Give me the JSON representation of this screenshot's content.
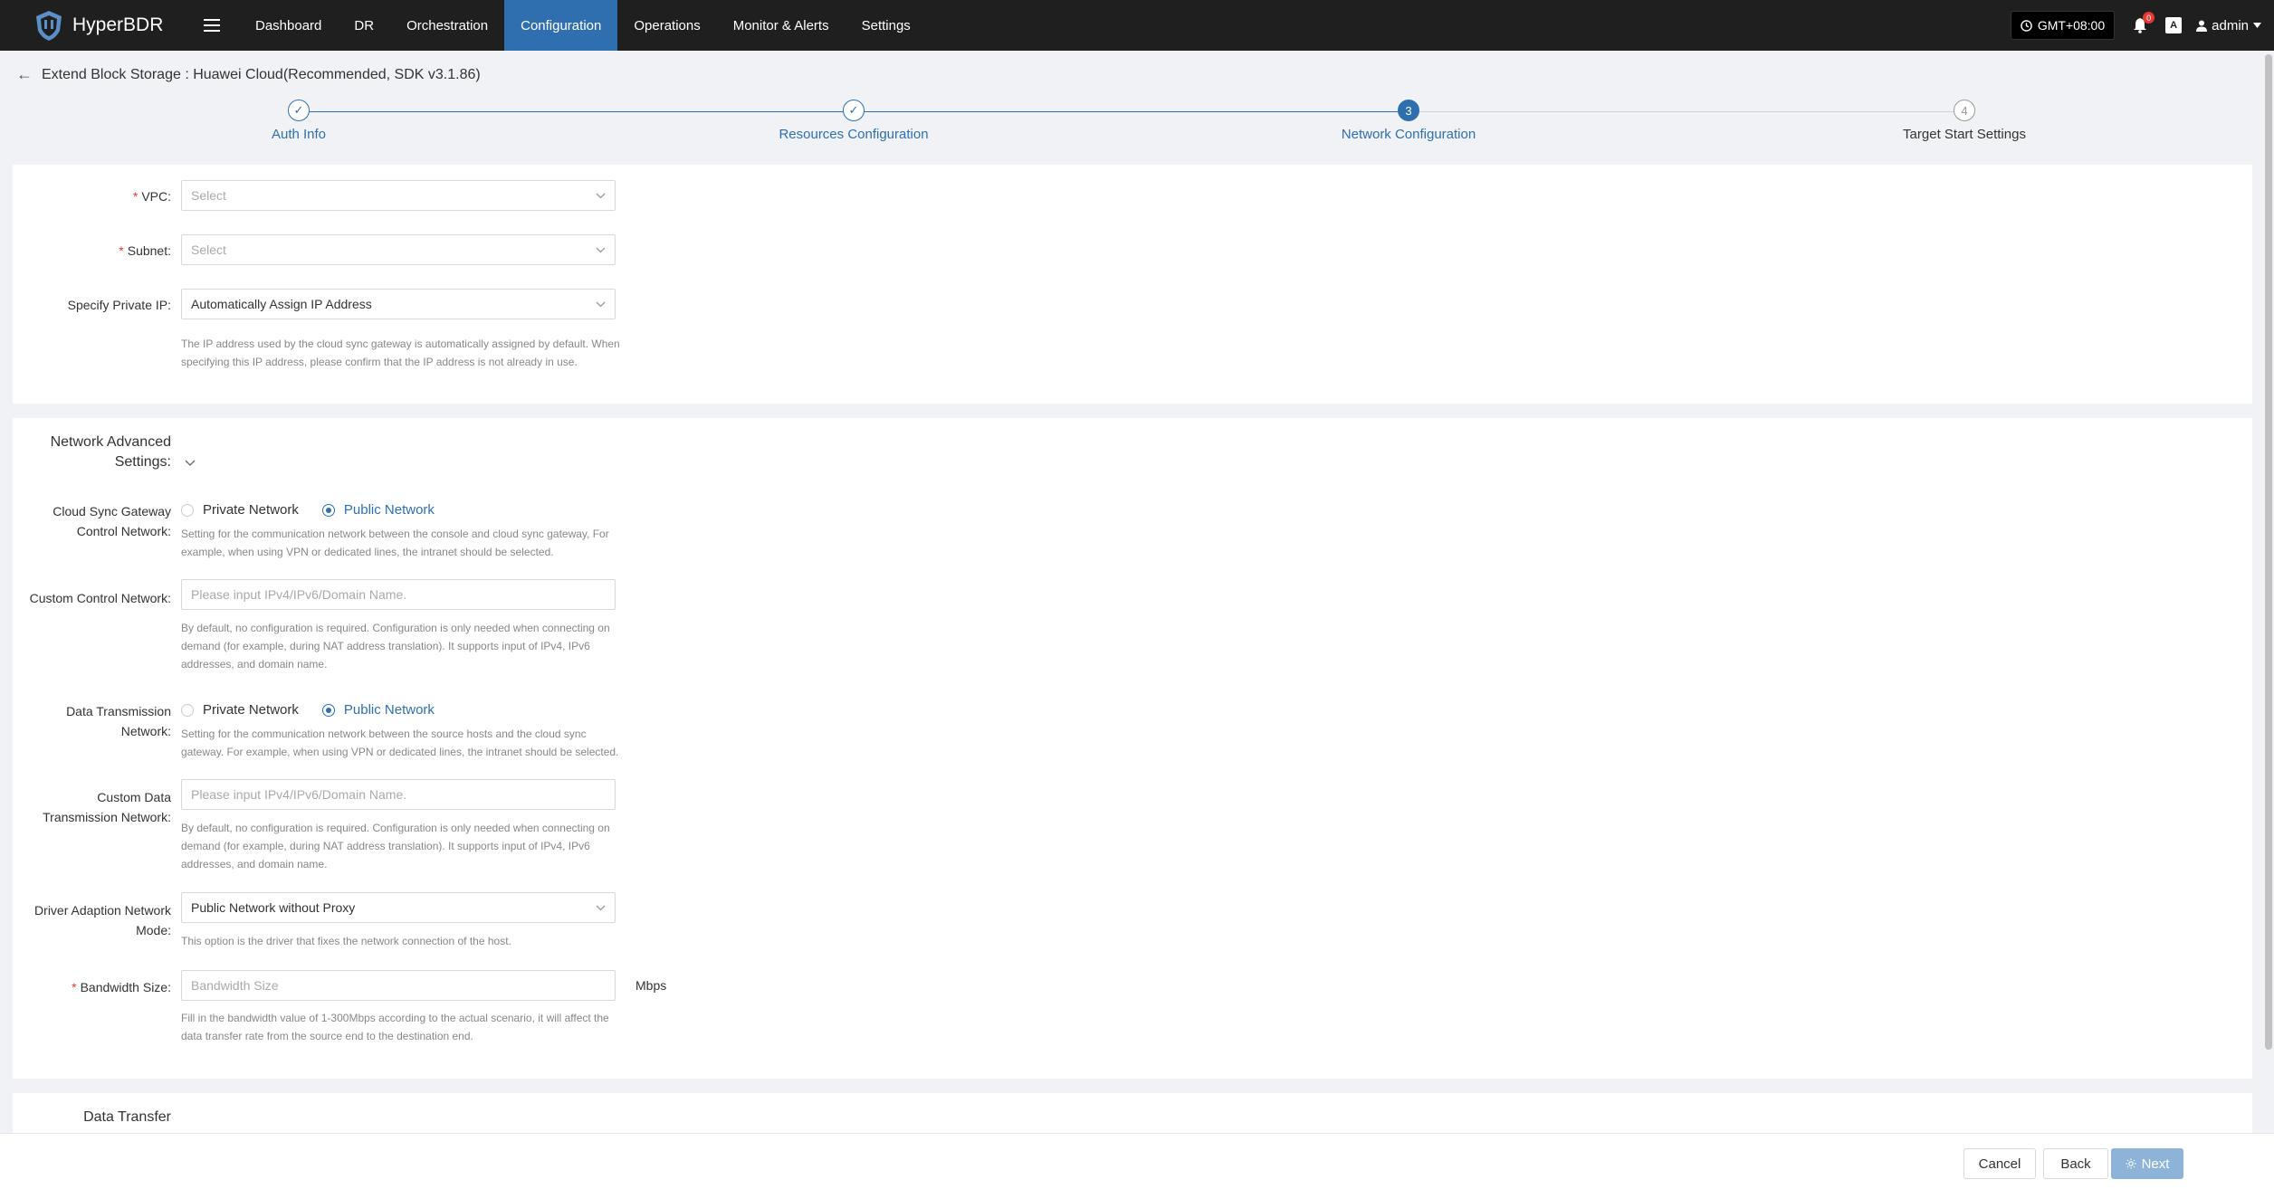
{
  "app": {
    "name": "HyperBDR"
  },
  "nav": {
    "items": [
      {
        "label": "Dashboard"
      },
      {
        "label": "DR"
      },
      {
        "label": "Orchestration"
      },
      {
        "label": "Configuration",
        "active": true
      },
      {
        "label": "Operations"
      },
      {
        "label": "Monitor & Alerts"
      },
      {
        "label": "Settings"
      }
    ],
    "timezone": "GMT+08:00",
    "notification_count": "0",
    "lang_glyph": "A",
    "user": "admin"
  },
  "page": {
    "title": "Extend Block Storage : Huawei Cloud(Recommended, SDK v3.1.86)"
  },
  "steps": [
    {
      "label": "Auth Info",
      "status": "done",
      "marker": "✓"
    },
    {
      "label": "Resources Configuration",
      "status": "done",
      "marker": "✓"
    },
    {
      "label": "Network Configuration",
      "status": "current",
      "marker": "3"
    },
    {
      "label": "Target Start Settings",
      "status": "todo",
      "marker": "4"
    }
  ],
  "network": {
    "vpc": {
      "label": "VPC:",
      "placeholder": "Select"
    },
    "subnet": {
      "label": "Subnet:",
      "placeholder": "Select"
    },
    "private_ip": {
      "label": "Specify Private IP:",
      "value": "Automatically Assign IP Address",
      "hint_line1": "The IP address used by the cloud sync gateway is automatically assigned by default. When",
      "hint_line2": "specifying this IP address, please confirm that the IP address is not already in use."
    }
  },
  "advanced": {
    "title_line1": "Network Advanced",
    "title_line2": "Settings:",
    "control_network": {
      "label_line1": "Cloud Sync Gateway",
      "label_line2": "Control Network:",
      "options": [
        "Private Network",
        "Public Network"
      ],
      "selected": "Public Network",
      "hint_line1": "Setting for the communication network between the console and cloud sync gateway, For",
      "hint_line2": "example, when using VPN or dedicated lines, the intranet should be selected."
    },
    "custom_control": {
      "label": "Custom Control Network:",
      "placeholder": "Please input IPv4/IPv6/Domain Name.",
      "hint_line1": "By default, no configuration is required. Configuration is only needed when connecting on",
      "hint_line2": "demand (for example, during NAT address translation). It supports input of IPv4, IPv6",
      "hint_line3": "addresses, and domain name."
    },
    "data_network": {
      "label_line1": "Data Transmission",
      "label_line2": "Network:",
      "options": [
        "Private Network",
        "Public Network"
      ],
      "selected": "Public Network",
      "hint_line1": "Setting for the communication network between the source hosts and the cloud sync",
      "hint_line2": "gateway. For example, when using VPN or dedicated lines, the intranet should be selected."
    },
    "custom_data": {
      "label_line1": "Custom Data",
      "label_line2": "Transmission Network:",
      "placeholder": "Please input IPv4/IPv6/Domain Name.",
      "hint_line1": "By default, no configuration is required. Configuration is only needed when connecting on",
      "hint_line2": "demand (for example, during NAT address translation). It supports input of IPv4, IPv6",
      "hint_line3": "addresses, and domain name."
    },
    "driver_mode": {
      "label_line1": "Driver Adaption Network",
      "label_line2": "Mode:",
      "value": "Public Network without Proxy",
      "hint": "This option is the driver that fixes the network connection of the host."
    },
    "bandwidth": {
      "label": "Bandwidth Size:",
      "placeholder": "Bandwidth Size",
      "unit": "Mbps",
      "hint_line1": "Fill in the bandwidth value of 1-300Mbps according to the actual scenario, it will affect the",
      "hint_line2": "data transfer rate from the source end to the destination end."
    }
  },
  "data_transfer": {
    "title_line1": "Data Transfer"
  },
  "footer": {
    "cancel": "Cancel",
    "back": "Back",
    "next": "Next"
  }
}
